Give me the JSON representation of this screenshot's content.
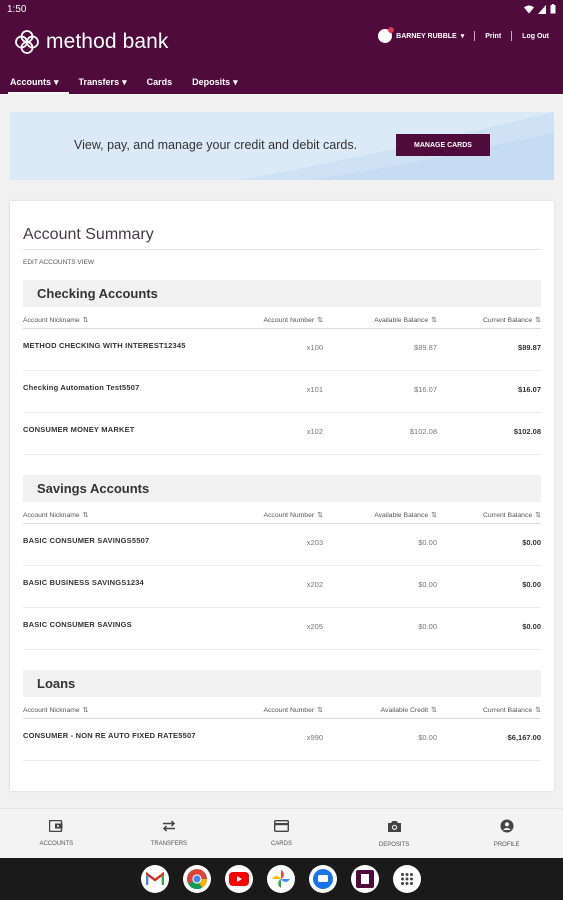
{
  "status_bar": {
    "time": "1:50"
  },
  "header": {
    "brand": "method bank",
    "user_name": "BARNEY RUBBLE",
    "print_label": "Print",
    "logout_label": "Log Out",
    "nav": [
      "Accounts",
      "Transfers",
      "Cards",
      "Deposits"
    ]
  },
  "banner": {
    "text": "View, pay, and manage your credit and debit cards.",
    "button_label": "MANAGE CARDS"
  },
  "summary": {
    "title": "Account Summary",
    "edit_link": "EDIT ACCOUNTS VIEW",
    "checking": {
      "title": "Checking Accounts",
      "headers": [
        "Account Nickname",
        "Account Number",
        "Available Balance",
        "Current Balance"
      ],
      "rows": [
        [
          "METHOD CHECKING WITH INTEREST12345",
          "x100",
          "$89.87",
          "$89.87"
        ],
        [
          "Checking Automation Test5507",
          "x101",
          "$16.07",
          "$16.07"
        ],
        [
          "CONSUMER MONEY MARKET",
          "x102",
          "$102.08",
          "$102.08"
        ]
      ]
    },
    "savings": {
      "title": "Savings Accounts",
      "headers": [
        "Account Nickname",
        "Account Number",
        "Available Balance",
        "Current Balance"
      ],
      "rows": [
        [
          "BASIC CONSUMER SAVINGS5507",
          "x203",
          "$0.00",
          "$0.00"
        ],
        [
          "BASIC BUSINESS SAVINGS1234",
          "x202",
          "$0.00",
          "$0.00"
        ],
        [
          "BASIC CONSUMER SAVINGS",
          "x205",
          "$0.00",
          "$0.00"
        ]
      ]
    },
    "loans": {
      "title": "Loans",
      "headers": [
        "Account Nickname",
        "Account Number",
        "Available Credit",
        "Current Balance"
      ],
      "rows": [
        [
          "CONSUMER - NON RE AUTO FIXED RATE5507",
          "x990",
          "$0.00",
          "$6,167.00"
        ]
      ]
    }
  },
  "bottom_nav": [
    {
      "label": "ACCOUNTS",
      "icon": "wallet-icon"
    },
    {
      "label": "TRANSFERS",
      "icon": "swap-arrows-icon"
    },
    {
      "label": "CARDS",
      "icon": "credit-card-icon"
    },
    {
      "label": "DEPOSITS",
      "icon": "camera-icon"
    },
    {
      "label": "PROFILE",
      "icon": "person-icon"
    }
  ],
  "dock_apps": [
    "gmail-icon",
    "chrome-icon",
    "youtube-icon",
    "photos-icon",
    "messages-icon",
    "method-bank-app-icon",
    "app-drawer-icon"
  ],
  "colors": {
    "brand": "#4e0b3b",
    "banner_bg": "#dceaf8"
  }
}
